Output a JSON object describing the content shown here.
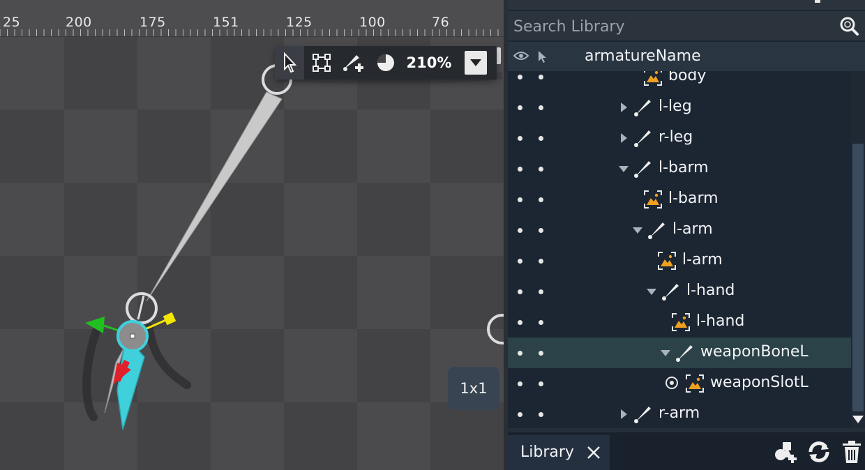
{
  "ruler": {
    "labels": [
      "25",
      "200",
      "175",
      "151",
      "125",
      "100",
      "76"
    ]
  },
  "toolbar": {
    "tools": [
      {
        "name": "select",
        "icon": "cursor-arrow-icon",
        "active": true
      },
      {
        "name": "transform",
        "icon": "transform-frame-icon"
      },
      {
        "name": "create-bone",
        "icon": "add-bone-icon"
      },
      {
        "name": "weight",
        "icon": "sphere-shade-icon"
      }
    ],
    "zoom": "210%",
    "dropdown_icon": "chevron-down-icon"
  },
  "canvas": {
    "size_badge": "1x1",
    "colors": {
      "selected_bone": "#3fd0dc",
      "axis_x": "#e0202a",
      "axis_y": "#20c020",
      "scale_handle": "#f3e600",
      "bone": "#c9c9c9"
    }
  },
  "library": {
    "search_placeholder": "Search Library",
    "armature_name": "armatureName",
    "rows": [
      {
        "label": "body",
        "type": "image",
        "depth": 3,
        "arrow": "none"
      },
      {
        "label": "l-leg",
        "type": "bone",
        "depth": 2,
        "arrow": "collapsed"
      },
      {
        "label": "r-leg",
        "type": "bone",
        "depth": 2,
        "arrow": "collapsed"
      },
      {
        "label": "l-barm",
        "type": "bone",
        "depth": 2,
        "arrow": "expanded"
      },
      {
        "label": "l-barm",
        "type": "image",
        "depth": 3,
        "arrow": "none"
      },
      {
        "label": "l-arm",
        "type": "bone",
        "depth": 3,
        "arrow": "expanded"
      },
      {
        "label": "l-arm",
        "type": "image",
        "depth": 4,
        "arrow": "none"
      },
      {
        "label": "l-hand",
        "type": "bone",
        "depth": 4,
        "arrow": "expanded"
      },
      {
        "label": "l-hand",
        "type": "image",
        "depth": 5,
        "arrow": "none"
      },
      {
        "label": "weaponBoneL",
        "type": "bone",
        "depth": 5,
        "arrow": "expanded",
        "selected": true
      },
      {
        "label": "weaponSlotL",
        "type": "image",
        "depth": 6,
        "arrow": "none",
        "target": true
      },
      {
        "label": "r-arm",
        "type": "bone",
        "depth": 2,
        "arrow": "collapsed"
      }
    ],
    "tab_label": "Library",
    "colors": {
      "panel_bg": "#1c2633",
      "selected_row": "#2a4248",
      "image_icon": "#f0a020"
    }
  }
}
